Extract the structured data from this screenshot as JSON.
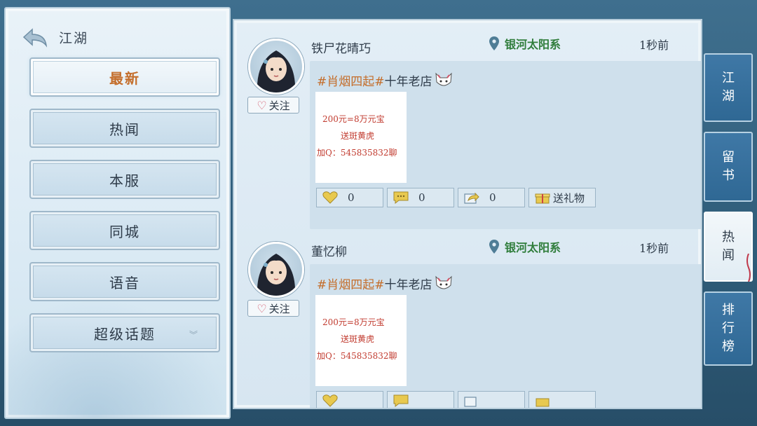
{
  "header": {
    "title": "江湖"
  },
  "menu": {
    "items": [
      {
        "label": "最新",
        "active": true
      },
      {
        "label": "热闻"
      },
      {
        "label": "本服"
      },
      {
        "label": "同城"
      },
      {
        "label": "语音"
      },
      {
        "label": "超级话题"
      }
    ]
  },
  "posts": [
    {
      "username": "铁尸花晴巧",
      "location": "银河太阳系",
      "time": "1秒前",
      "follow_label": "关注",
      "tag": "#肖烟四起#",
      "text": "十年老店",
      "image_lines": [
        "200元=8万元宝",
        "送斑黄虎",
        "加Q：545835832聊"
      ],
      "likes": "0",
      "comments": "0",
      "shares": "0",
      "gift_label": "送礼物"
    },
    {
      "username": "董忆柳",
      "location": "银河太阳系",
      "time": "1秒前",
      "follow_label": "关注",
      "tag": "#肖烟四起#",
      "text": "十年老店",
      "image_lines": [
        "200元=8万元宝",
        "送斑黄虎",
        "加Q：545835832聊"
      ],
      "likes": "",
      "comments": "",
      "shares": "",
      "gift_label": ""
    }
  ],
  "side_tabs": [
    {
      "label": "江湖"
    },
    {
      "label": "留书"
    },
    {
      "label": "热闻",
      "active": true
    },
    {
      "label": "排行榜"
    }
  ],
  "colors": {
    "accent_orange": "#c46e2c",
    "location_green": "#2f7d3b",
    "tab_blue": "#3f78a6"
  }
}
